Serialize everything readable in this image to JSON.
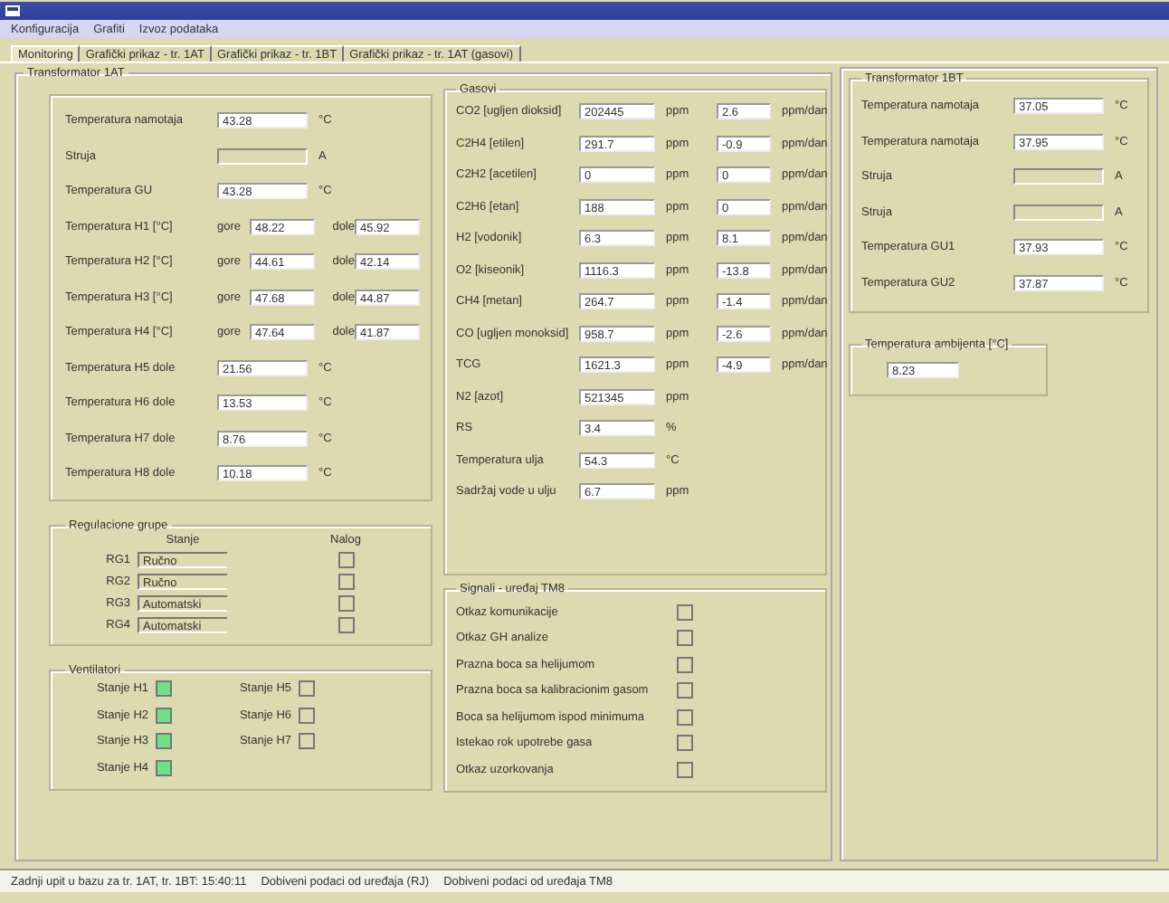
{
  "menu": [
    "Konfiguracija",
    "Grafiti",
    "Izvoz podataka"
  ],
  "tabs": [
    {
      "label": "Monitoring",
      "selected": true
    },
    {
      "label": "Grafički prikaz - tr. 1AT",
      "selected": false
    },
    {
      "label": "Grafički prikaz - tr. 1BT",
      "selected": false
    },
    {
      "label": "Grafički prikaz - tr. 1AT (gasovi)",
      "selected": false
    }
  ],
  "transformer_1at": {
    "title": "Transformator 1AT",
    "rows": [
      {
        "kind": "single",
        "label": "Temperatura namotaja",
        "value": "43.28",
        "unit": "°C",
        "disabled": false
      },
      {
        "kind": "single",
        "label": "Struja",
        "unit": "A",
        "disabled": true
      },
      {
        "kind": "single",
        "label": "Temperatura GU",
        "value": "43.28",
        "unit": "°C",
        "disabled": false
      },
      {
        "kind": "pair",
        "label": "Temperatura H1 [°C]",
        "top_label": "gore",
        "top_value": "48.22",
        "bottom_label": "dole",
        "bottom_value": "45.92"
      },
      {
        "kind": "pair",
        "label": "Temperatura H2 [°C]",
        "top_label": "gore",
        "top_value": "44.61",
        "bottom_label": "dole",
        "bottom_value": "42.14"
      },
      {
        "kind": "pair",
        "label": "Temperatura H3 [°C]",
        "top_label": "gore",
        "top_value": "47.68",
        "bottom_label": "dole",
        "bottom_value": "44.87"
      },
      {
        "kind": "pair",
        "label": "Temperatura H4 [°C]",
        "top_label": "gore",
        "top_value": "47.64",
        "bottom_label": "dole",
        "bottom_value": "41.87"
      },
      {
        "kind": "single",
        "label": "Temperatura H5 dole",
        "value": "21.56",
        "unit": "°C",
        "disabled": false
      },
      {
        "kind": "single",
        "label": "Temperatura H6 dole",
        "value": "13.53",
        "unit": "°C",
        "disabled": false
      },
      {
        "kind": "single",
        "label": "Temperatura H7 dole",
        "value": "8.76",
        "unit": "°C",
        "disabled": false
      },
      {
        "kind": "single",
        "label": "Temperatura H8 dole",
        "value": "10.18",
        "unit": "°C",
        "disabled": false
      }
    ]
  },
  "regulation_groups": {
    "title": "Regulacione grupe",
    "state_header": "Stanje",
    "order_header": "Nalog",
    "rows": [
      {
        "label": "RG1",
        "state": "Ručno",
        "checked": false
      },
      {
        "label": "RG2",
        "state": "Ručno",
        "checked": false
      },
      {
        "label": "RG3",
        "state": "Automatski",
        "checked": false
      },
      {
        "label": "RG4",
        "state": "Automatski",
        "checked": false
      }
    ]
  },
  "fans": {
    "title": "Ventilatori",
    "left": [
      {
        "label": "Stanje H1",
        "on": true
      },
      {
        "label": "Stanje H2",
        "on": true
      },
      {
        "label": "Stanje H3",
        "on": true
      },
      {
        "label": "Stanje H4",
        "on": true
      }
    ],
    "right": [
      {
        "label": "Stanje H5",
        "on": false
      },
      {
        "label": "Stanje H6",
        "on": false
      },
      {
        "label": "Stanje H7",
        "on": false
      }
    ]
  },
  "gases": {
    "title": "Gasovi",
    "rows": [
      {
        "label": "CO2 [ugljen dioksid]",
        "value": "202445",
        "unit": "ppm",
        "rate": "2.6",
        "rate_unit": "ppm/dan"
      },
      {
        "label": "C2H4 [etilen]",
        "value": "291.7",
        "unit": "ppm",
        "rate": "-0.9",
        "rate_unit": "ppm/dan"
      },
      {
        "label": "C2H2 [acetilen]",
        "value": "0",
        "unit": "ppm",
        "rate": "0",
        "rate_unit": "ppm/dan"
      },
      {
        "label": "C2H6 [etan]",
        "value": "188",
        "unit": "ppm",
        "rate": "0",
        "rate_unit": "ppm/dan"
      },
      {
        "label": "H2 [vodonik]",
        "value": "6.3",
        "unit": "ppm",
        "rate": "8.1",
        "rate_unit": "ppm/dan"
      },
      {
        "label": "O2 [kiseonik]",
        "value": "1116.3",
        "unit": "ppm",
        "rate": "-13.8",
        "rate_unit": "ppm/dan"
      },
      {
        "label": "CH4 [metan]",
        "value": "264.7",
        "unit": "ppm",
        "rate": "-1.4",
        "rate_unit": "ppm/dan"
      },
      {
        "label": "CO [ugljen monoksid]",
        "value": "958.7",
        "unit": "ppm",
        "rate": "-2.6",
        "rate_unit": "ppm/dan"
      },
      {
        "label": "TCG",
        "value": "1621.3",
        "unit": "ppm",
        "rate": "-4.9",
        "rate_unit": "ppm/dan"
      },
      {
        "label": "N2 [azot]",
        "value": "521345",
        "unit": "ppm"
      },
      {
        "label": "RS",
        "value": "3.4",
        "unit": "%"
      },
      {
        "label": "Temperatura ulja",
        "value": "54.3",
        "unit": "°C"
      },
      {
        "label": "Sadržaj vode u ulju",
        "value": "6.7",
        "unit": "ppm"
      }
    ]
  },
  "signals": {
    "title": "Signali - uređaj TM8",
    "rows": [
      {
        "label": "Otkaz komunikacije",
        "checked": false
      },
      {
        "label": "Otkaz GH analize",
        "checked": false
      },
      {
        "label": "Prazna boca sa helijumom",
        "checked": false
      },
      {
        "label": "Prazna boca sa kalibracionim gasom",
        "checked": false
      },
      {
        "label": "Boca sa helijumom ispod minimuma",
        "checked": false
      },
      {
        "label": "Istekao rok upotrebe gasa",
        "checked": false
      },
      {
        "label": "Otkaz uzorkovanja",
        "checked": false
      }
    ]
  },
  "transformer_1bt": {
    "title": "Transformator 1BT",
    "rows": [
      {
        "label": "Temperatura namotaja",
        "value": "37.05",
        "unit": "°C",
        "disabled": false
      },
      {
        "label": "Temperatura namotaja",
        "value": "37.95",
        "unit": "°C",
        "disabled": false
      },
      {
        "label": "Struja",
        "unit": "A",
        "disabled": true
      },
      {
        "label": "Struja",
        "unit": "A",
        "disabled": true
      },
      {
        "label": "Temperatura GU1",
        "value": "37.93",
        "unit": "°C",
        "disabled": false
      },
      {
        "label": "Temperatura GU2",
        "value": "37.87",
        "unit": "°C",
        "disabled": false
      }
    ]
  },
  "ambient": {
    "title": "Temperatura ambijenta [°C]",
    "value": "8.23"
  },
  "status_bar": [
    "Zadnji upit u bazu za tr. 1AT, tr. 1BT: 15:40:11",
    "Dobiveni podaci od uređaja (RJ)",
    "Dobiveni podaci od uređaja TM8"
  ]
}
